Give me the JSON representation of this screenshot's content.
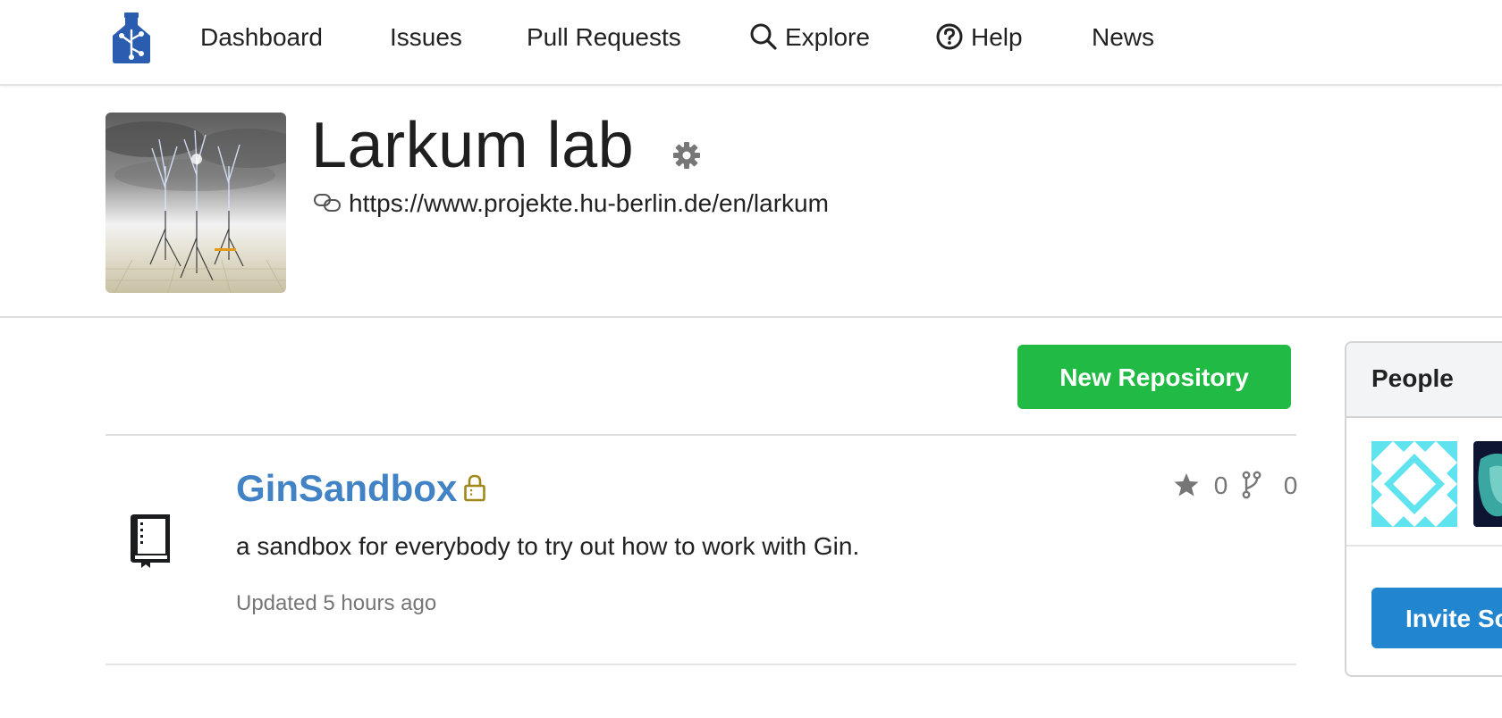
{
  "nav": {
    "logo_icon": "gin-logo-icon",
    "items": [
      {
        "label": "Dashboard"
      },
      {
        "label": "Issues"
      },
      {
        "label": "Pull Requests"
      },
      {
        "label": "Explore",
        "icon": "search-icon"
      },
      {
        "label": "Help",
        "icon": "question-circle-icon"
      },
      {
        "label": "News"
      }
    ]
  },
  "org": {
    "name": "Larkum lab",
    "website": "https://www.projekte.hu-berlin.de/en/larkum",
    "settings_icon": "gear-icon",
    "link_icon": "link-icon"
  },
  "actions": {
    "new_repo_label": "New Repository"
  },
  "repos": [
    {
      "name": "GinSandbox",
      "private": true,
      "description": "a sandbox for everybody to try out how to work with Gin.",
      "updated": "Updated 5 hours ago",
      "stars": "0",
      "forks": "0"
    }
  ],
  "people": {
    "title": "People",
    "invite_label": "Invite So"
  },
  "colors": {
    "accent_green": "#21ba45",
    "link_blue": "#4183c4",
    "button_blue": "#2185d0",
    "lock_gold": "#a0891b"
  }
}
